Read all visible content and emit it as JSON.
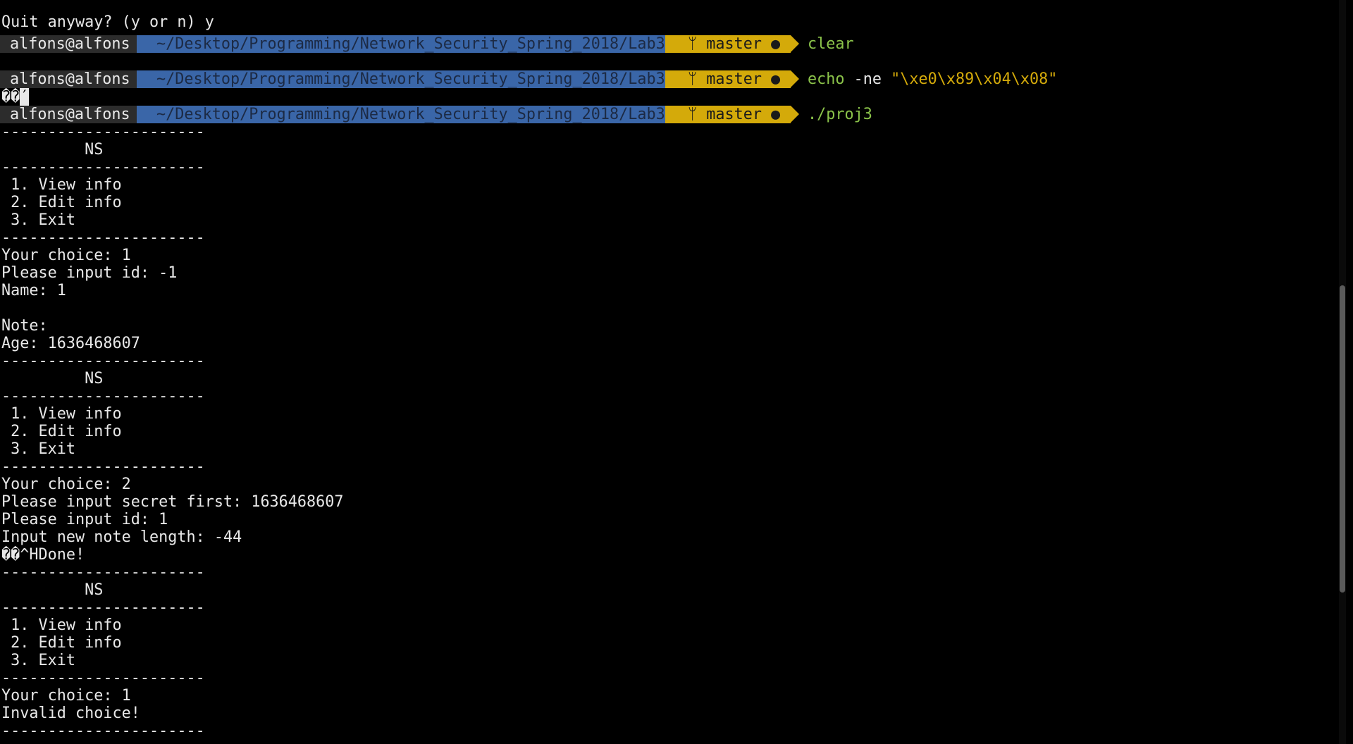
{
  "terminal": {
    "top_line": "Quit anyway? (y or n) y",
    "prompt": {
      "user": "alfons@alfons",
      "path": "~/Desktop/Programming/Network_Security_Spring_2018/Lab3",
      "branch": "ᛘ master ●"
    },
    "commands": [
      {
        "word": "clear",
        "rest": "",
        "arg": ""
      },
      {
        "word": "echo",
        "rest": " -ne ",
        "arg": "\"\\xe0\\x89\\x04\\x08\""
      },
      {
        "word": "./proj3",
        "rest": "",
        "arg": ""
      }
    ],
    "echo_output": "��",
    "echo_cursor_glyph": "′",
    "output": [
      "----------------------",
      "         NS",
      "----------------------",
      " 1. View info",
      " 2. Edit info",
      " 3. Exit",
      "----------------------",
      "Your choice: 1",
      "Please input id: -1",
      "Name: 1",
      "",
      "Note:",
      "Age: 1636468607",
      "----------------------",
      "         NS",
      "----------------------",
      " 1. View info",
      " 2. Edit info",
      " 3. Exit",
      "----------------------",
      "Your choice: 2",
      "Please input secret first: 1636468607",
      "Please input id: 1",
      "Input new note length: -44",
      "��^HDone!",
      "----------------------",
      "         NS",
      "----------------------",
      " 1. View info",
      " 2. Edit info",
      " 3. Exit",
      "----------------------",
      "Your choice: 1",
      "Invalid choice!",
      "----------------------"
    ]
  },
  "colors": {
    "background": "#000000",
    "text": "#e8e8e8",
    "user_segment": "#2c2c2c",
    "path_segment": "#3a66a8",
    "git_segment": "#d4aa0a",
    "command": "#8bc34a",
    "string_arg": "#d4aa0a"
  }
}
